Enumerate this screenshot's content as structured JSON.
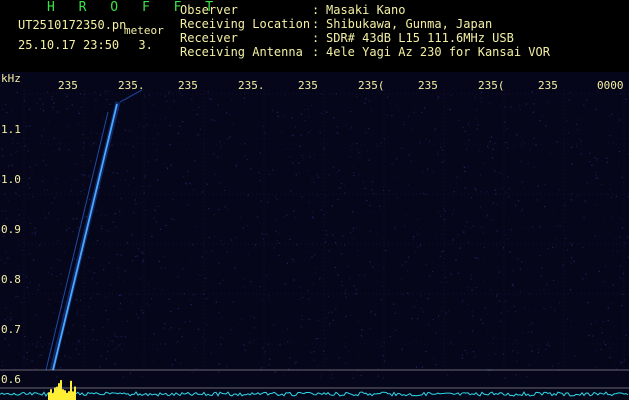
{
  "header": {
    "app_title": "H R O F F T",
    "filename": "UT2510172350.pn",
    "tag": "meteor",
    "datetime": "25.10.17 23:50",
    "status": "3.",
    "fields": [
      {
        "key": "Observer",
        "value": "Masaki Kano"
      },
      {
        "key": "Receiving Location",
        "value": "Shibukawa, Gunma, Japan"
      },
      {
        "key": "Receiver",
        "value": "SDR# 43dB L15 111.6MHz USB"
      },
      {
        "key": "Receiving Antenna",
        "value": "4ele Yagi Az 230 for Kansai VOR"
      }
    ]
  },
  "axis": {
    "y_unit": "kHz",
    "y_ticks": [
      "1.1",
      "1.0",
      "0.9",
      "0.8",
      "0.7",
      "0.6"
    ],
    "x_ticks": [
      "235",
      "235.",
      "235",
      "235.",
      "235",
      "235(",
      "235",
      "235(",
      "235",
      "0000"
    ]
  },
  "colors": {
    "text": "#f4f0a3",
    "title": "#3be34b",
    "background": "#06061a",
    "trace": "#4aa8ff",
    "spectrum": "#2fd8e8",
    "peak": "#ffee33"
  }
}
